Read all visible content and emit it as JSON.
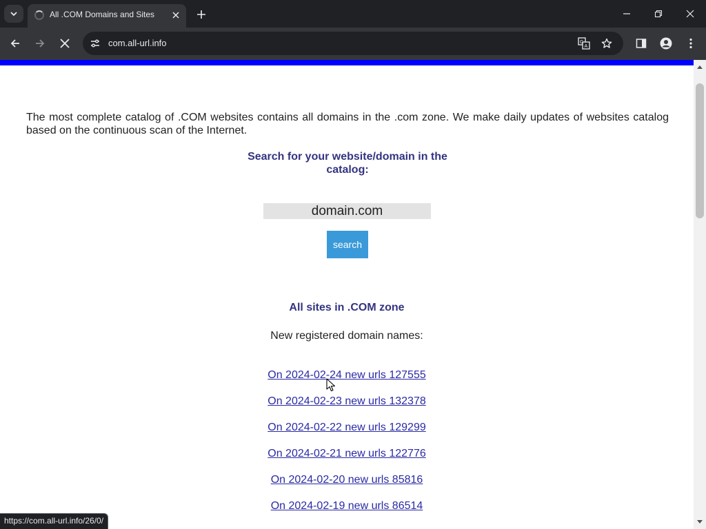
{
  "browser": {
    "tab_title": "All .COM Domains and Sites",
    "url": "com.all-url.info",
    "status_url": "https://com.all-url.info/26/0/"
  },
  "icons": {
    "tab_search": "chevron-down-icon",
    "tab_loading": "spinner-icon",
    "tab_close": "close-icon",
    "new_tab": "plus-icon",
    "minimize": "minimize-icon",
    "restore": "restore-icon",
    "close_window": "close-icon",
    "back": "arrow-left-icon",
    "forward": "arrow-right-icon",
    "stop": "stop-icon",
    "site_info": "tune-icon",
    "translate": "translate-icon",
    "bookmark": "star-icon",
    "side_panel": "side-panel-icon",
    "profile": "profile-icon",
    "menu": "kebab-menu-icon"
  },
  "colors": {
    "accent_strip": "#0000ff",
    "heading": "#333380",
    "link": "#2a2aa5",
    "search_button": "#3a9ad9"
  },
  "page": {
    "intro": "The most complete catalog of .COM websites contains all domains in the .com zone. We make daily updates of websites catalog based on the continuous scan of the Internet.",
    "search_heading": "Search for your website/domain in the catalog:",
    "search_input_value": "domain.com",
    "search_button": "search",
    "zone_heading": "All sites in .COM zone",
    "new_registered": "New registered domain names:",
    "daily_links": [
      "On 2024-02-24 new urls 127555",
      "On 2024-02-23 new urls 132378",
      "On 2024-02-22 new urls 129299",
      "On 2024-02-21 new urls 122776",
      "On 2024-02-20 new urls 85816",
      "On 2024-02-19 new urls 86514"
    ]
  }
}
